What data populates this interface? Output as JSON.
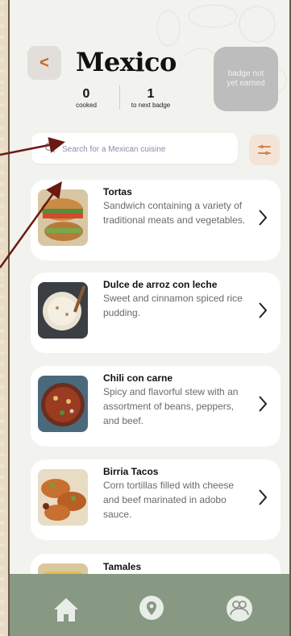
{
  "header": {
    "title": "Mexico",
    "stats": [
      {
        "value": "0",
        "label": "cooked"
      },
      {
        "value": "1",
        "label": "to next badge"
      }
    ],
    "badge_text": "badge not yet earned"
  },
  "search": {
    "placeholder": "Search for a Mexican cuisine",
    "value": ""
  },
  "dishes": [
    {
      "name": "Tortas",
      "description": "Sandwich containing a variety of traditional meats and vegetables."
    },
    {
      "name": "Dulce de arroz con leche",
      "description": "Sweet and cinnamon spiced rice pudding."
    },
    {
      "name": "Chili con carne",
      "description": "Spicy and flavorful stew with an assortment of beans, peppers, and beef."
    },
    {
      "name": "Birria Tacos",
      "description": "Corn tortillas filled with cheese and beef marinated in adobo sauce."
    },
    {
      "name": "Tamales",
      "description": ""
    }
  ],
  "nav": {
    "items": [
      {
        "icon": "home-icon"
      },
      {
        "icon": "location-pin-icon"
      },
      {
        "icon": "community-icon"
      }
    ]
  },
  "colors": {
    "accent": "#c9621f",
    "navbar": "#879883",
    "arrow": "#6a1a12"
  }
}
